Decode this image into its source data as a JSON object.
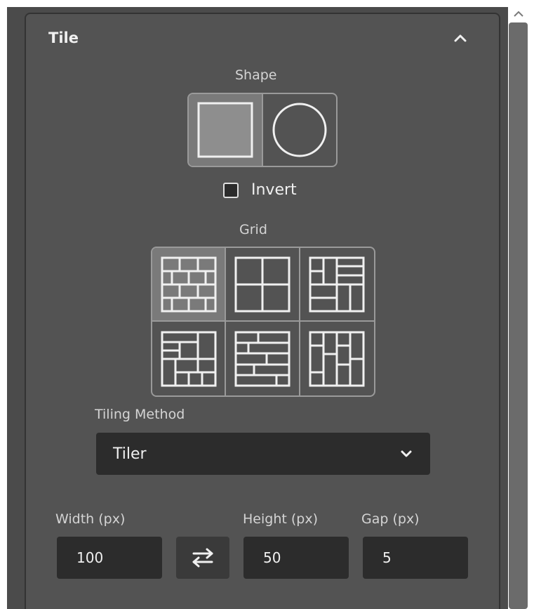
{
  "panel": {
    "title": "Tile",
    "collapse_icon": "chevron-up-icon"
  },
  "shape": {
    "label": "Shape",
    "options": [
      {
        "name": "square",
        "selected": true
      },
      {
        "name": "circle",
        "selected": false
      }
    ]
  },
  "invert": {
    "label": "Invert",
    "checked": false
  },
  "grid": {
    "label": "Grid",
    "patterns": [
      {
        "name": "brick",
        "selected": true
      },
      {
        "name": "quad",
        "selected": false
      },
      {
        "name": "herringbone-1",
        "selected": false
      },
      {
        "name": "basket",
        "selected": false
      },
      {
        "name": "staggered",
        "selected": false
      },
      {
        "name": "parquet",
        "selected": false
      }
    ]
  },
  "tiling_method": {
    "label": "Tiling Method",
    "value": "Tiler"
  },
  "dimensions": {
    "width_label": "Width (px)",
    "width_value": "100",
    "height_label": "Height (px)",
    "height_value": "50",
    "gap_label": "Gap (px)",
    "gap_value": "5",
    "swap_icon": "swap-arrows-icon"
  },
  "colors": {
    "panel_bg": "#535353",
    "app_bg": "#4b4b4b",
    "field_bg": "#2c2c2c",
    "selected_bg": "#7a7a7a",
    "text": "#f0f0f0"
  }
}
